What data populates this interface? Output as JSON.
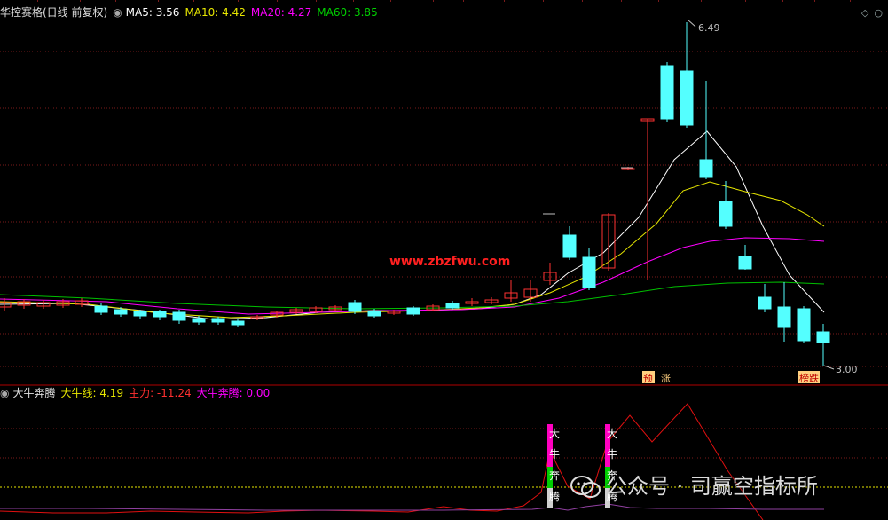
{
  "header": {
    "title": "华控赛格(日线 前复权)",
    "ma5": "MA5: 3.56",
    "ma10": "MA10: 4.42",
    "ma20": "MA20: 4.27",
    "ma60": "MA60: 3.85"
  },
  "price_panel": {
    "high_label": "6.49",
    "low_label": "3.00",
    "url_watermark": "www.zbzfwu.com",
    "tags": [
      "预",
      "涨",
      "榜跌"
    ]
  },
  "indicator_panel": {
    "name": "大牛奔腾",
    "line1": "大牛线: 4.19",
    "line2": "主力: -11.24",
    "line3": "大牛奔腾: 0.00",
    "signal_chars": [
      "大",
      "牛",
      "奔",
      "腾"
    ]
  },
  "watermark_text": "公众号 · 司赢空指标所",
  "colors": {
    "up": "#ff3232",
    "down": "#54ffff",
    "ma5": "#ffffff",
    "ma10": "#e6e600",
    "ma20": "#ff00ff",
    "ma60": "#00c000",
    "grid": "#7a1a1a",
    "text_axis": "#c0c0c0"
  },
  "icons": [
    "circle-icon",
    "diamond-icon",
    "circle-settings-icon"
  ]
}
